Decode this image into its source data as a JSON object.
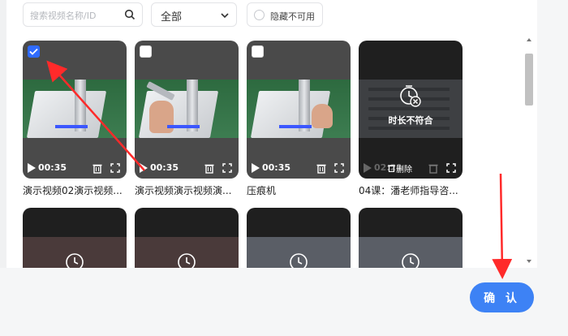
{
  "filters": {
    "search_placeholder": "搜索视频名称/ID",
    "category_value": "全部",
    "hide_unavailable_label": "隐藏不可用"
  },
  "videos": [
    {
      "title": "演示视频02演示视频...",
      "duration": "00:35",
      "selected": true
    },
    {
      "title": "演示视频演示视频演...",
      "duration": "00:35",
      "selected": false
    },
    {
      "title": "压痕机",
      "duration": "00:35",
      "selected": false
    },
    {
      "title": "04课：潘老师指导咨...",
      "duration": "02:21",
      "status": "时长不符合",
      "delete_label": "删除"
    }
  ],
  "confirm_label": "确 认",
  "colors": {
    "accent": "#3d82f5",
    "annotation": "#ff2a2a"
  }
}
